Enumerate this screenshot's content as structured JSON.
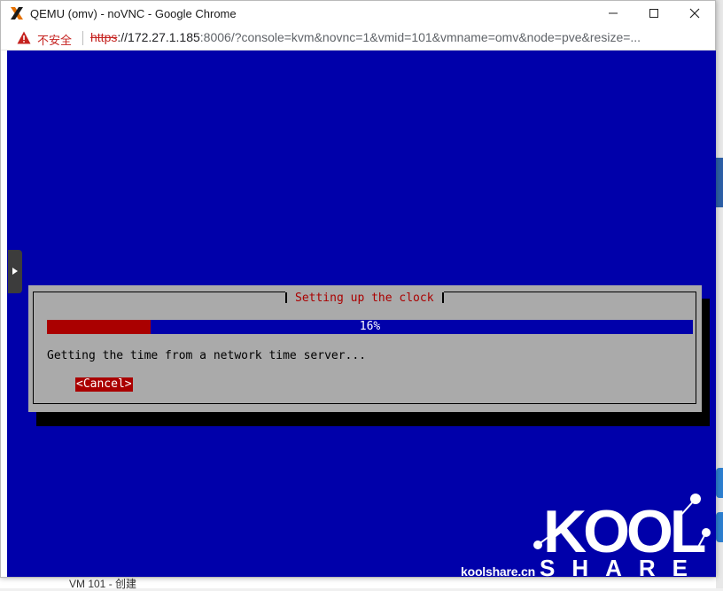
{
  "window": {
    "title": "QEMU (omv) - noVNC - Google Chrome"
  },
  "addressbar": {
    "security_label": "不安全",
    "url_scheme": "https",
    "url_host": "://172.27.1.185",
    "url_rest": ":8006/?console=kvm&novnc=1&vmid=101&vmname=omv&node=pve&resize=..."
  },
  "installer": {
    "dialog_title": "Setting up the clock",
    "progress_percent": 16,
    "progress_label": "16%",
    "message": "Getting the time from a network time server...",
    "cancel_label": "<Cancel>"
  },
  "watermark": {
    "site": "koolshare.cn",
    "logo_top": "KOOL",
    "logo_bottom": "SHARE"
  },
  "background_app": {
    "footer_text": "VM 101 - 创建"
  },
  "colors": {
    "console_bg": "#0000aa",
    "dialog_bg": "#aaaaaa",
    "accent_red": "#aa0000",
    "insecure_red": "#c5221f"
  },
  "icons": {
    "app": "proxmox-x-icon",
    "warning": "warning-triangle-icon",
    "minimize": "minimize-icon",
    "maximize": "maximize-icon",
    "close": "close-icon",
    "handle": "chevron-right-icon"
  }
}
